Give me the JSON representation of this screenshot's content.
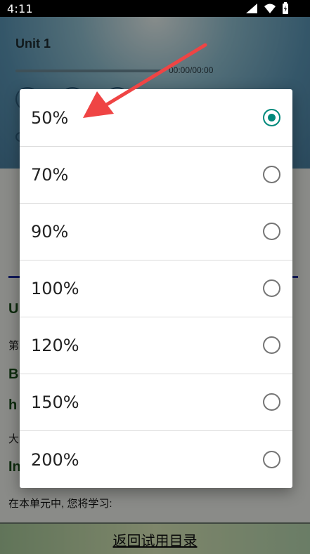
{
  "status_bar": {
    "time": "4:11"
  },
  "player": {
    "unit_title": "Unit 1",
    "time_display": "00:00/00:00"
  },
  "content": {
    "heading_fragment": "U",
    "line2_fragment": "第",
    "bold_b": "B",
    "bold_h": "h",
    "line_da": "大",
    "bold_in": "In",
    "learn_text": "在本单元中, 您将学习:"
  },
  "footer": {
    "return_link": "返回试用目录"
  },
  "dialog": {
    "options": [
      {
        "label": "50%",
        "selected": true
      },
      {
        "label": "70%",
        "selected": false
      },
      {
        "label": "90%",
        "selected": false
      },
      {
        "label": "100%",
        "selected": false
      },
      {
        "label": "120%",
        "selected": false
      },
      {
        "label": "150%",
        "selected": false
      },
      {
        "label": "200%",
        "selected": false
      }
    ]
  },
  "colors": {
    "accent": "#00897b",
    "annotation_arrow": "#ef4444"
  }
}
